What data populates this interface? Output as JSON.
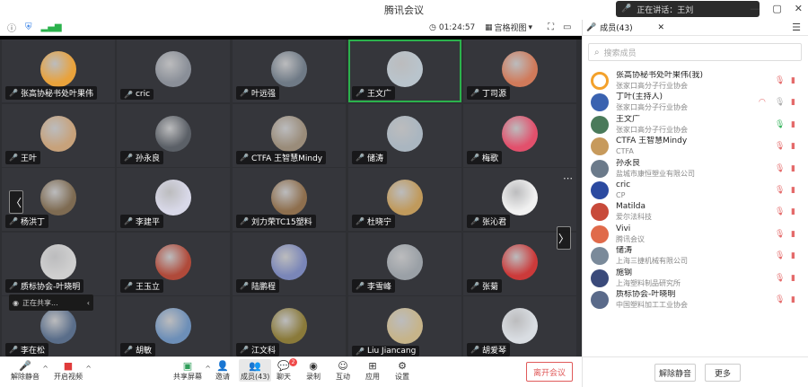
{
  "window": {
    "title": "腾讯会议",
    "speaker_text": "正在讲话：王刘",
    "min_icon": "—",
    "max_icon": "▢",
    "close_icon": "✕"
  },
  "infobar": {
    "timer": "01:24:57",
    "view_label": "宫格视图",
    "members_tab": "成员(43)"
  },
  "tiles": [
    {
      "label": "张高协秘书处叶果伟",
      "mic": "muted"
    },
    {
      "label": "cric",
      "mic": "muted"
    },
    {
      "label": "叶远强",
      "mic": "muted"
    },
    {
      "label": "王文广",
      "mic": "on"
    },
    {
      "label": "丁司源",
      "mic": "muted"
    },
    {
      "label": "王叶",
      "mic": "muted"
    },
    {
      "label": "孙永良",
      "mic": "muted"
    },
    {
      "label": "CTFA 王智慧Mindy",
      "mic": "muted"
    },
    {
      "label": "储涛",
      "mic": "muted"
    },
    {
      "label": "梅歌",
      "mic": "muted"
    },
    {
      "label": "杨洪丁",
      "mic": "muted"
    },
    {
      "label": "李建平",
      "mic": "muted"
    },
    {
      "label": "刘力荣TC15塑料",
      "mic": "muted"
    },
    {
      "label": "杜晓宁",
      "mic": "muted"
    },
    {
      "label": "张沁君",
      "mic": "muted"
    },
    {
      "label": "质标协会-叶晓明",
      "mic": "muted"
    },
    {
      "label": "王玉立",
      "mic": "muted"
    },
    {
      "label": "陆鹏程",
      "mic": "muted"
    },
    {
      "label": "李雪峰",
      "mic": "muted"
    },
    {
      "label": "张菊",
      "mic": "muted"
    },
    {
      "label": "李在松",
      "mic": "muted"
    },
    {
      "label": "胡敏",
      "mic": "muted"
    },
    {
      "label": "江文科",
      "mic": "muted"
    },
    {
      "label": "Liu Jiancang",
      "mic": "muted"
    },
    {
      "label": "胡爱琴",
      "mic": "muted"
    }
  ],
  "mini_bar": {
    "text": "正在共享..."
  },
  "toolbar": {
    "unmute": "解除静音",
    "start_video": "开启视频",
    "share_screen": "共享屏幕",
    "invite": "邀请",
    "members": "成员(43)",
    "chat": "聊天",
    "chat_badge": "2",
    "record": "录制",
    "interact": "互动",
    "apps": "应用",
    "settings": "设置",
    "leave": "离开会议"
  },
  "panel": {
    "search_placeholder": "搜索成员",
    "members": [
      {
        "name": "张高协秘书处叶果伟(我)",
        "org": "张家口高分子行业协会",
        "mic": "muted",
        "cam": true
      },
      {
        "name": "丁叶(主持人)",
        "org": "张家口高分子行业协会",
        "mic": "gray",
        "cam": true,
        "live": true
      },
      {
        "name": "王文广",
        "org": "张家口高分子行业协会",
        "mic": "on",
        "cam": true
      },
      {
        "name": "CTFA 王智慧Mindy",
        "org": "CTFA",
        "mic": "muted",
        "cam": true
      },
      {
        "name": "孙永良",
        "org": "盐城市康恒塑业有限公司",
        "mic": "muted",
        "cam": true
      },
      {
        "name": "cric",
        "org": "CP",
        "mic": "muted",
        "cam": true
      },
      {
        "name": "Matilda",
        "org": "爱尔法科技",
        "mic": "muted",
        "cam": true
      },
      {
        "name": "Vivi",
        "org": "腾讯会议",
        "mic": "muted",
        "cam": true
      },
      {
        "name": "储涛",
        "org": "上海三捷机械有限公司",
        "mic": "muted",
        "cam": true
      },
      {
        "name": "施钢",
        "org": "上海塑料制品研究所",
        "mic": "muted",
        "cam": true
      },
      {
        "name": "质标协会-叶晓明",
        "org": "中国塑料加工工业协会",
        "mic": "muted",
        "cam": true
      }
    ],
    "manage_btn": "解除静音",
    "more_btn": "更多"
  }
}
